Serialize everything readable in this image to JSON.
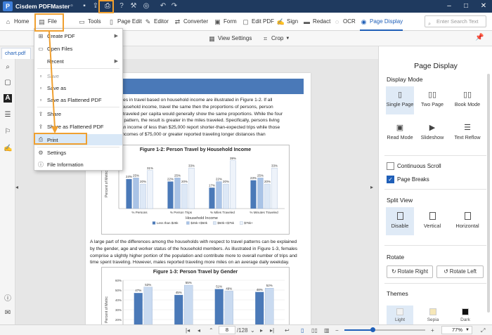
{
  "app": {
    "title": "Cisdem PDFMaster",
    "logo_letter": "P"
  },
  "toolbar": {
    "home": "Home",
    "file": "File",
    "tools": "Tools",
    "page_edit": "Page Edit",
    "editor": "Editor",
    "converter": "Converter",
    "form": "Form",
    "edit_pdf": "Edit PDF",
    "sign": "Sign",
    "redact": "Redact",
    "ocr": "OCR",
    "page_display": "Page Display",
    "search_placeholder": "Enter Search Text"
  },
  "subbar": {
    "view_settings": "View Settings",
    "crop": "Crop"
  },
  "tab": {
    "name": "chart.pdf"
  },
  "file_menu": {
    "items": [
      {
        "label": "Create PDF",
        "icon": "plus-doc-icon",
        "submenu": true,
        "disabled": false
      },
      {
        "label": "Open Files",
        "icon": "folder-icon",
        "submenu": false,
        "disabled": false
      },
      {
        "label": "Recent",
        "icon": "",
        "submenu": true,
        "disabled": false
      },
      {
        "label": "Save",
        "icon": "save-icon",
        "submenu": false,
        "disabled": true
      },
      {
        "label": "Save as",
        "icon": "save-as-icon",
        "submenu": false,
        "disabled": false
      },
      {
        "label": "Save as Flattened PDF",
        "icon": "flatten-icon",
        "submenu": false,
        "disabled": false
      },
      {
        "label": "Share",
        "icon": "share-icon",
        "submenu": false,
        "disabled": false
      },
      {
        "label": "Share as Flattened PDF",
        "icon": "share-flat-icon",
        "submenu": false,
        "disabled": false
      },
      {
        "label": "Print",
        "icon": "print-icon",
        "submenu": false,
        "disabled": false
      },
      {
        "label": "Settings",
        "icon": "gear-icon",
        "submenu": false,
        "disabled": false
      },
      {
        "label": "File Information",
        "icon": "info-icon",
        "submenu": false,
        "disabled": false
      }
    ]
  },
  "document": {
    "chapter": "R 1",
    "para1": [
      "differences in travel based on household income are illustrated in Figure 1-2. If all",
      "ess of household income, travel the same then the proportions of persons, person",
      "minutes traveled per capita would generally show the same proportions. While the four",
      "a similar pattern, the result is greater in the miles traveled. Specifically, persons living",
      "porting an income of less than $25,000 report shorter-than-expected trips while those",
      "porting incomes of $75,000 or greater reported traveling longer distances than"
    ],
    "para2": [
      "A large part of the differences among the households with respect to travel patterns can be explained",
      "by the gender, age and worker status of the household members. As illustrated in Figure 1-3, females",
      "comprise a slightly higher portion of the population and contribute more to overall number of trips and",
      "time spent traveling. However, males reported traveling more miles on an average daily weekday."
    ]
  },
  "chart_data": [
    {
      "type": "bar",
      "title": "Figure 1-2:  Person Travel by Household Income",
      "xlabel": "Household Income",
      "ylabel": "Percent of Metric",
      "categories": [
        "% Persons",
        "% Person Trips",
        "% Miles Traveled",
        "% Minutes Traveled"
      ],
      "series": [
        {
          "name": "Less than $25k",
          "values": [
            24,
            22,
            17,
            23
          ],
          "color": "#4a79b8"
        },
        {
          "name": "$25k-<$50k",
          "values": [
            25,
            25,
            22,
            25
          ],
          "color": "#a9c3e6"
        },
        {
          "name": "$50k-<$75k",
          "values": [
            20,
            20,
            20,
            20
          ],
          "color": "#dde8f6"
        },
        {
          "name": "$75k+",
          "values": [
            31,
            33,
            39,
            33
          ],
          "color": "#eef3fa"
        }
      ],
      "ylim": [
        0,
        40
      ],
      "legend": "bottom"
    },
    {
      "type": "bar",
      "title": "Figure 1-3:  Person Travel by Gender",
      "ylabel": "Percent of Metric",
      "yticks": [
        "0%",
        "10%",
        "20%",
        "30%",
        "40%",
        "50%",
        "60%"
      ],
      "categories": [
        "% Persons",
        "% Person Trips",
        "% Miles Traveled",
        "% Minutes Traveled"
      ],
      "series": [
        {
          "name": "",
          "values": [
            47,
            45,
            51,
            48
          ],
          "color": "#4a79b8"
        },
        {
          "name": "",
          "values": [
            53,
            55,
            49,
            52
          ],
          "color": "#c9daf0"
        }
      ],
      "ylim": [
        0,
        60
      ]
    }
  ],
  "right_panel": {
    "title": "Page Display",
    "display_mode_label": "Display Mode",
    "modes": [
      "Single Page",
      "Two Page",
      "Book Mode",
      "Read Mode",
      "Slideshow",
      "Text Reflow"
    ],
    "continuous_scroll": "Continuous Scroll",
    "page_breaks": "Page Breaks",
    "split_view_label": "Split View",
    "splits": [
      "Disable",
      "Vertical",
      "Horizontal"
    ],
    "rotate_label": "Rotate",
    "rotate_right": "Rotate Right",
    "rotate_left": "Rotate Left",
    "themes_label": "Themes",
    "themes": [
      "Light",
      "Sepia",
      "Dark"
    ],
    "theme_colors": [
      "#f2f2f2",
      "#f6e7b8",
      "#111111"
    ]
  },
  "status": {
    "current_page": "8",
    "total_pages": "/128",
    "zoom": "77%",
    "zoom_level": 0.77
  }
}
